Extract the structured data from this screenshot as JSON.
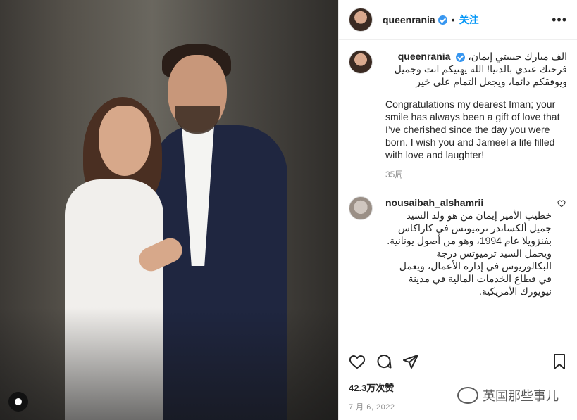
{
  "post": {
    "author": "queenrania",
    "follow_label": "关注",
    "separator": "•",
    "more_label": "•••"
  },
  "caption": {
    "username": "queenrania",
    "arabic": "الف مبارك حبيبتي إيمان، فرحتك عندي بالدنيا! الله يهنيكم انت وجميل ويوفقكم دائما، ويجعل التمام على خير",
    "english": "Congratulations my dearest Iman; your smile has always been a gift of love that I’ve cherished since the day you were born. I wish you and Jameel a life filled with love and laughter!",
    "age": "35周"
  },
  "comment": {
    "username": "nousaibah_alshamrii",
    "text": "خطيب الأمير إيمان من هو ولد السيد جميل ألكساندر ترميوتس في كاراكاس بفنزويلا عام 1994، وهو من أصول يونانية. ويحمل السيد ترميوتس درجة البكالوريوس في إدارة الأعمال، ويعمل في قطاع الخدمات المالية في مدينة نيويورك الأمريكية."
  },
  "stats": {
    "likes": "42.3万次赞",
    "date": "7 月 6, 2022"
  },
  "watermark": {
    "text": "英国那些事儿"
  },
  "icons": [
    "heart-icon",
    "comment-icon",
    "share-icon",
    "bookmark-icon",
    "verified-icon",
    "more-icon"
  ]
}
